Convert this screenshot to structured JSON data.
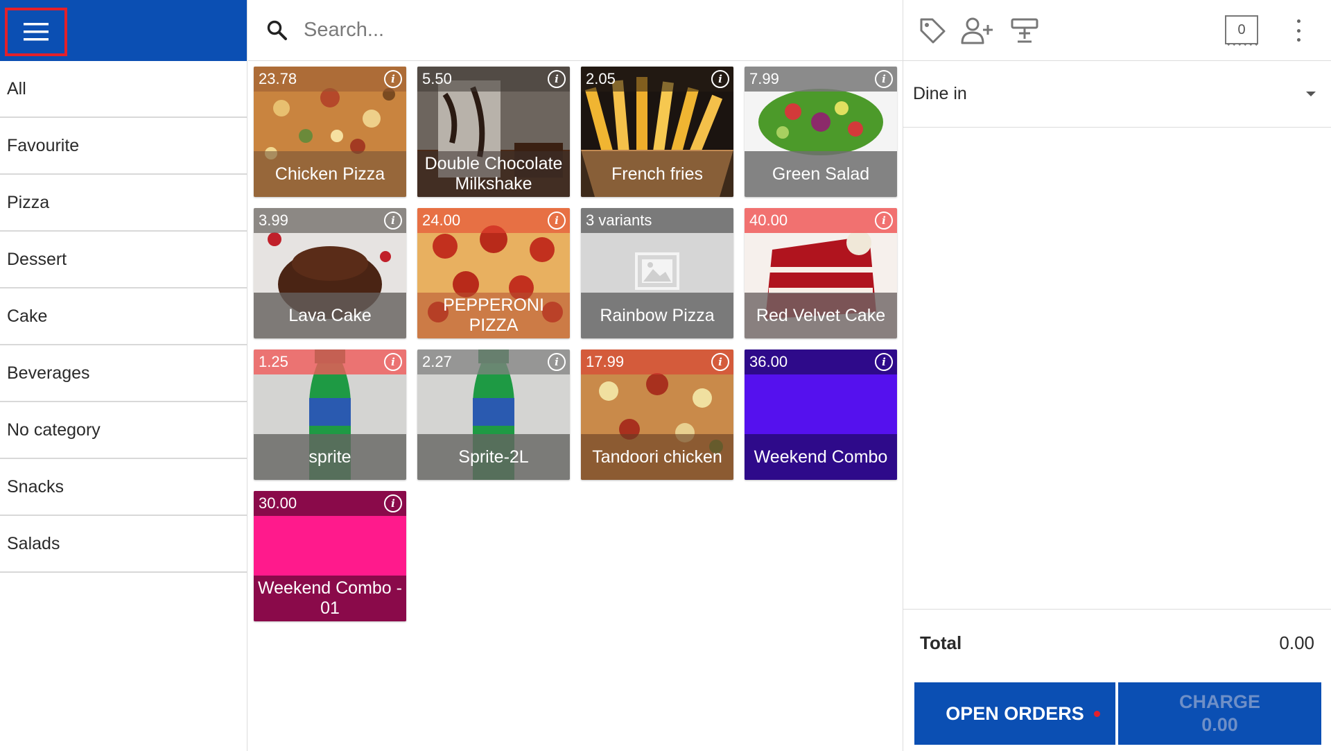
{
  "colors": {
    "brand_blue": "#0b4fb3",
    "menu_highlight": "#e4202a",
    "notification_dot": "#e4202a"
  },
  "sidebar": {
    "menu_icon": "hamburger-menu-icon",
    "categories": [
      {
        "label": "All"
      },
      {
        "label": "Favourite"
      },
      {
        "label": "Pizza"
      },
      {
        "label": "Dessert"
      },
      {
        "label": "Cake"
      },
      {
        "label": "Beverages"
      },
      {
        "label": "No category"
      },
      {
        "label": "Snacks"
      },
      {
        "label": "Salads"
      }
    ]
  },
  "search": {
    "icon": "search-icon",
    "placeholder": "Search..."
  },
  "products": [
    {
      "price": "23.78",
      "name": "Chicken Pizza",
      "image": "pizza-photo",
      "info": true
    },
    {
      "price": "5.50",
      "name": "Double Chocolate Milkshake",
      "image": "milkshake-photo",
      "info": true
    },
    {
      "price": "2.05",
      "name": "French fries",
      "image": "fries-photo",
      "info": true
    },
    {
      "price": "7.99",
      "name": "Green Salad",
      "image": "salad-photo",
      "info": true
    },
    {
      "price": "3.99",
      "name": "Lava Cake",
      "image": "lava-cake-photo",
      "info": true
    },
    {
      "price": "24.00",
      "name": "PEPPERONI PIZZA",
      "image": "pepperoni-photo",
      "info": true
    },
    {
      "price": "3 variants",
      "name": "Rainbow Pizza",
      "image": "placeholder-image-icon",
      "info": false
    },
    {
      "price": "40.00",
      "name": "Red Velvet Cake",
      "image": "red-velvet-photo",
      "info": true
    },
    {
      "price": "1.25",
      "name": "sprite",
      "image": "sprite-bottle-photo",
      "info": true
    },
    {
      "price": "2.27",
      "name": "Sprite-2L",
      "image": "sprite-bottle-photo",
      "info": true
    },
    {
      "price": "17.99",
      "name": "Tandoori chicken",
      "image": "tandoori-pizza-photo",
      "info": true
    },
    {
      "price": "36.00",
      "name": "Weekend Combo",
      "image": "solid-color",
      "color": "#5511ee",
      "info": true
    },
    {
      "price": "30.00",
      "name": "Weekend Combo - 01",
      "image": "solid-color",
      "color": "#ff1a8c",
      "info": true
    }
  ],
  "panel": {
    "toolbar_icons": [
      "tag-icon",
      "add-customer-icon",
      "dining-table-icon"
    ],
    "ticket_count": "0",
    "menu_icon": "more-vert-icon",
    "dining_option": "Dine in",
    "total_label": "Total",
    "total_value": "0.00",
    "open_orders_label": "OPEN ORDERS",
    "charge_label": "CHARGE",
    "charge_amount": "0.00"
  }
}
